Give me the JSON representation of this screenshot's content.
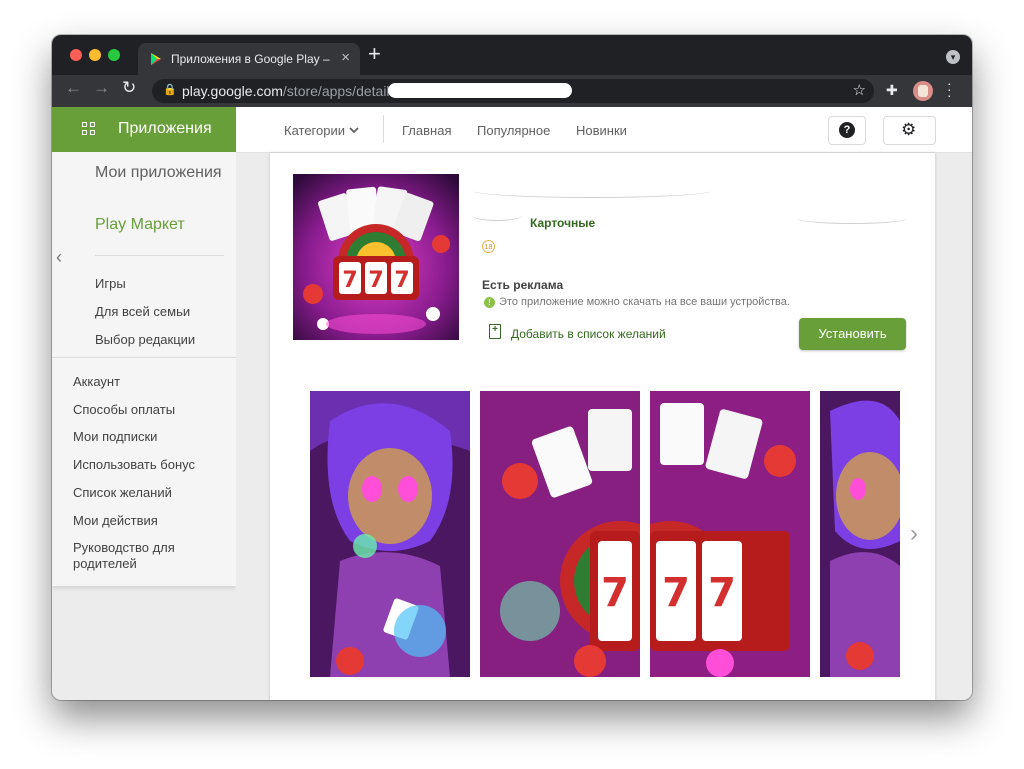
{
  "browser": {
    "tab_title": "Приложения в Google Play – \\",
    "tab_close": "×",
    "new_tab": "+",
    "url_host": "play.google.com",
    "url_path": "/store/apps/detail",
    "nav_back": "←",
    "nav_forward": "→",
    "nav_reload": "↻",
    "lock_icon": "🔒",
    "star_icon": "☆",
    "extensions_icon": "✚"
  },
  "header": {
    "apps_title": "Приложения",
    "categories_label": "Категории",
    "home_label": "Главная",
    "popular_label": "Популярное",
    "new_label": "Новинки",
    "help_glyph": "?",
    "settings_glyph": "⚙"
  },
  "sidebar": {
    "my_apps": "Мои приложения",
    "play_market": "Play Маркет",
    "collapse_glyph": "‹",
    "items": [
      "Игры",
      "Для всей семьи",
      "Выбор редакции"
    ],
    "account_items": [
      "Аккаунт",
      "Способы оплаты",
      "Мои подписки",
      "Использовать бонус",
      "Список желаний",
      "Мои действия",
      "Руководство для родителей"
    ]
  },
  "app": {
    "category": "Карточные",
    "age_rating": "18",
    "contains_ads": "Есть реклама",
    "info_glyph": "!",
    "devices_note": "Это приложение можно скачать на все ваши устройства.",
    "wishlist_glyph": "+",
    "wishlist_label": "Добавить в список желаний",
    "install_label": "Установить",
    "next_glyph": "›"
  },
  "colors": {
    "play_green": "#689f38",
    "play_dark_green": "#33691e",
    "rating_orange": "#ebb04c",
    "artwork_magenta": "#c02ca8",
    "artwork_purple": "#3d0d4a"
  }
}
